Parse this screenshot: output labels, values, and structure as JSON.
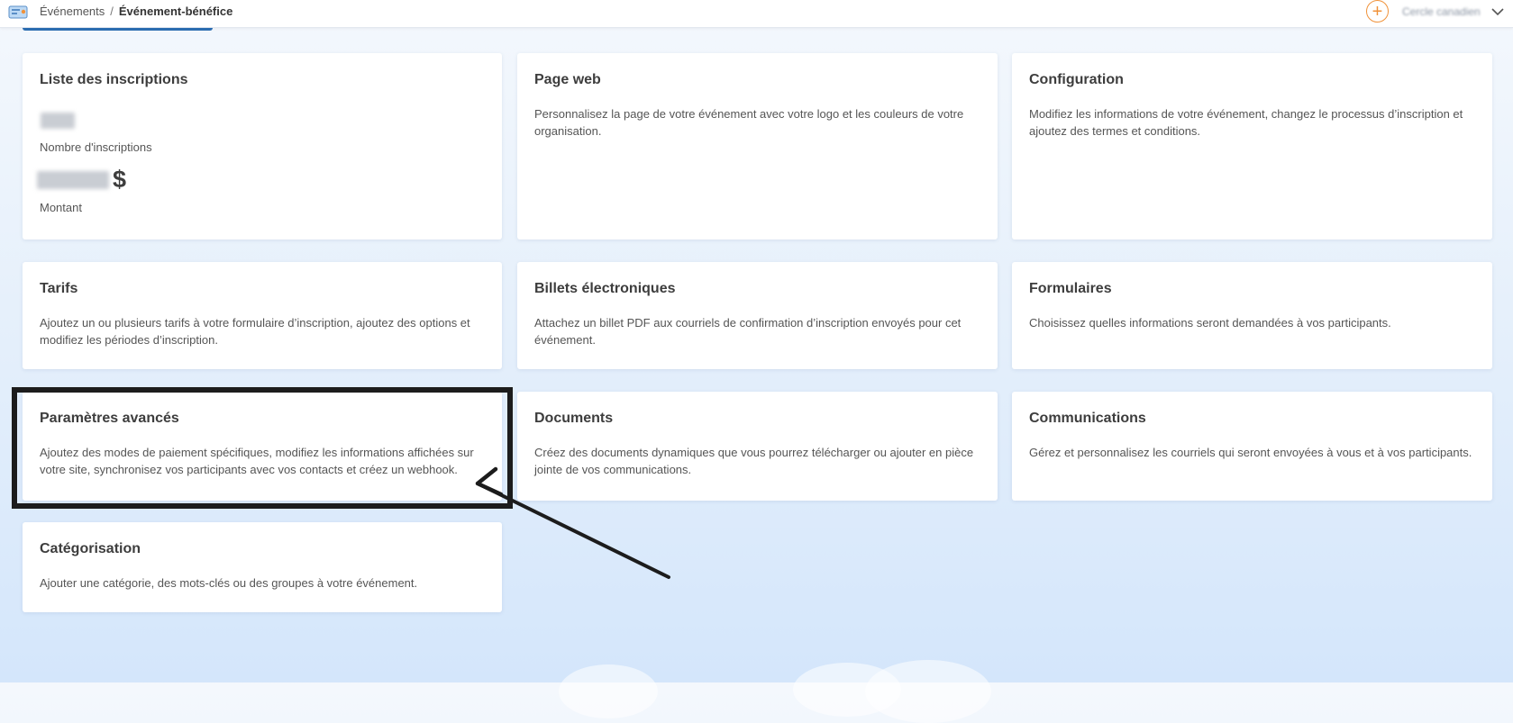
{
  "header": {
    "breadcrumb": {
      "parent": "Événements",
      "separator": "/",
      "current": "Événement-bénéfice"
    },
    "add_icon": "+",
    "user_name": "Cercle canadien",
    "chevron_icon": "chevron-down-icon"
  },
  "cards": {
    "registrations": {
      "title": "Liste des inscriptions",
      "count_label": "Nombre d'inscriptions",
      "currency_symbol": "$",
      "amount_label": "Montant"
    },
    "webpage": {
      "title": "Page web",
      "description": "Personnalisez la page de votre événement avec votre logo et les couleurs de votre organisation."
    },
    "configuration": {
      "title": "Configuration",
      "description": "Modifiez les informations de votre événement, changez le processus d’inscription et ajoutez des termes et conditions."
    },
    "rates": {
      "title": "Tarifs",
      "description": "Ajoutez un ou plusieurs tarifs à votre formulaire d’inscription, ajoutez des options et modifiez les périodes d’inscription."
    },
    "tickets": {
      "title": "Billets électroniques",
      "description": "Attachez un billet PDF aux courriels de confirmation d’inscription envoyés pour cet événement."
    },
    "forms": {
      "title": "Formulaires",
      "description": "Choisissez quelles informations seront demandées à vos participants."
    },
    "advanced": {
      "title": "Paramètres avancés",
      "description": "Ajoutez des modes de paiement spécifiques, modifiez les informations affichées sur votre site, synchronisez vos participants avec vos contacts et créez un webhook."
    },
    "documents": {
      "title": "Documents",
      "description": "Créez des documents dynamiques que vous pourrez télécharger ou ajouter en pièce jointe de vos communications."
    },
    "communications": {
      "title": "Communications",
      "description": "Gérez et personnalisez les courriels qui seront envoyées à vous et à vos participants."
    },
    "categorization": {
      "title": "Catégorisation",
      "description": "Ajouter une catégorie, des mots-clés ou des groupes à votre événement."
    }
  },
  "colors": {
    "accent_orange": "#f0923a",
    "tab_blue": "#2b6cb0",
    "annotation_black": "#1c1c1c"
  }
}
